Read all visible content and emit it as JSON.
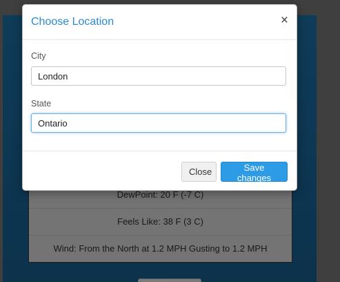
{
  "background_details": {
    "rows": [
      "DewPoint: 20 F (-7 C)",
      "Feels Like: 38 F (3 C)",
      "Wind: From the North at 1.2 MPH Gusting to 1.2 MPH"
    ]
  },
  "modal": {
    "title": "Choose Location",
    "close_icon": "×",
    "city_label": "City",
    "city_value": "London",
    "state_label": "State",
    "state_value": "Ontario",
    "close_button": "Close",
    "save_button": "Save changes"
  },
  "colors": {
    "title": "#2a8ad1",
    "primary_button": "#2d9be6",
    "panel": "#1f78b0"
  }
}
